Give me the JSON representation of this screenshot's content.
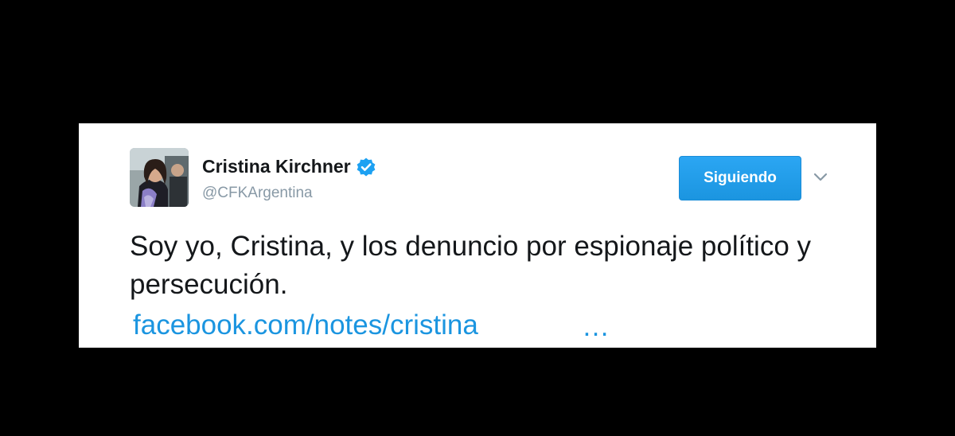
{
  "tweet": {
    "author": {
      "display_name": "Cristina Kirchner",
      "handle": "@CFKArgentina",
      "verified_icon": "verified-badge-icon",
      "avatar": "profile-photo"
    },
    "follow_button_label": "Siguiendo",
    "menu_icon": "chevron-down-icon",
    "text": "Soy yo, Cristina, y los denuncio por espionaje político y persecución.",
    "link_text": "facebook.com/notes/cristina",
    "link_ellipsis": "…"
  },
  "colors": {
    "background": "#000000",
    "card": "#ffffff",
    "name": "#14171a",
    "handle": "#8899a6",
    "accent": "#1da1f2",
    "link": "#1b95e0"
  }
}
